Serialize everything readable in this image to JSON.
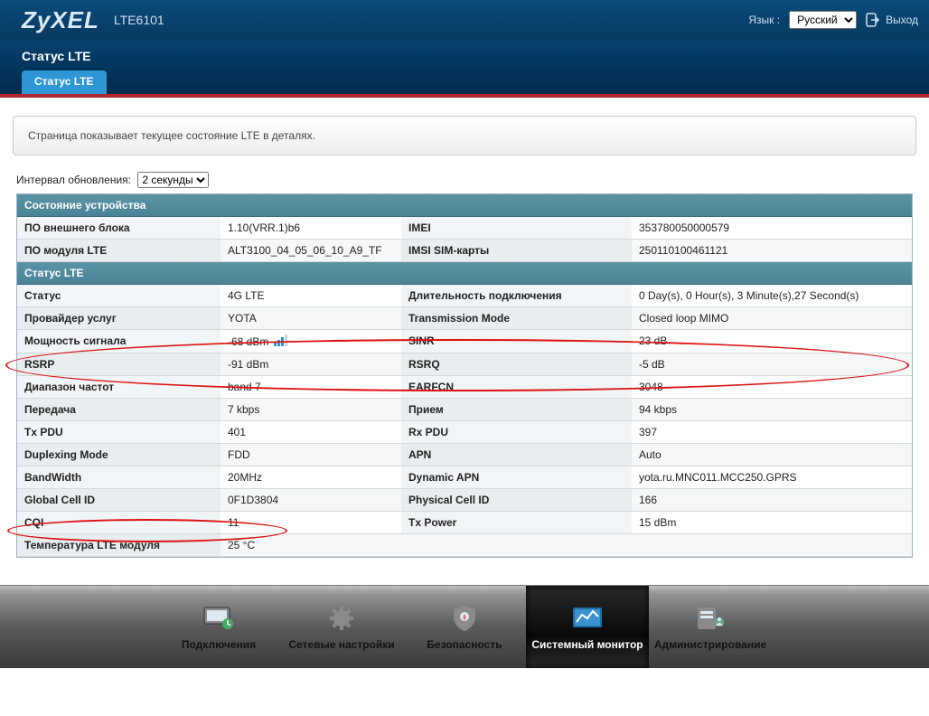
{
  "header": {
    "brand": "ZyXEL",
    "model": "LTE6101",
    "lang_label": "Язык :",
    "lang_value": "Русский",
    "logout": "Выход"
  },
  "page": {
    "title": "Статус LTE",
    "tabs": [
      {
        "label": "Статус LTE",
        "active": true
      }
    ]
  },
  "infobox": "Страница показывает текущее состояние LTE в деталях.",
  "interval": {
    "label": "Интервал обновления:",
    "value": "2 секунды"
  },
  "sections": {
    "device": {
      "title": "Состояние устройства",
      "rows": [
        {
          "l1": "ПО внешнего блока",
          "v1": "1.10(VRR.1)b6",
          "l2": "IMEI",
          "v2": "353780050000579"
        },
        {
          "l1": "ПО модуля LTE",
          "v1": "ALT3100_04_05_06_10_A9_TF",
          "l2": "IMSI SIM-карты",
          "v2": "250110100461121"
        }
      ]
    },
    "lte": {
      "title": "Статус LTE",
      "rows": [
        {
          "l1": "Статус",
          "v1": "4G LTE",
          "l2": "Длительность подключения",
          "v2": "0 Day(s), 0 Hour(s), 3 Minute(s),27 Second(s)"
        },
        {
          "l1": "Провайдер услуг",
          "v1": "YOTA",
          "l2": "Transmission Mode",
          "v2": "Closed loop MIMO"
        },
        {
          "l1": "Мощность сигнала",
          "v1": "-68 dBm",
          "l2": "SINR",
          "v2": "23 dB",
          "signal": true
        },
        {
          "l1": "RSRP",
          "v1": "-91 dBm",
          "l2": "RSRQ",
          "v2": "-5 dB"
        },
        {
          "l1": "Диапазон частот",
          "v1": "band 7",
          "l2": "EARFCN",
          "v2": "3048"
        },
        {
          "l1": "Передача",
          "v1": "7 kbps",
          "l2": "Прием",
          "v2": "94 kbps"
        },
        {
          "l1": "Tx PDU",
          "v1": "401",
          "l2": "Rx PDU",
          "v2": "397"
        },
        {
          "l1": "Duplexing Mode",
          "v1": "FDD",
          "l2": "APN",
          "v2": "Auto"
        },
        {
          "l1": "BandWidth",
          "v1": "20MHz",
          "l2": "Dynamic APN",
          "v2": "yota.ru.MNC011.MCC250.GPRS"
        },
        {
          "l1": "Global Cell ID",
          "v1": "0F1D3804",
          "l2": "Physical Cell ID",
          "v2": "166"
        },
        {
          "l1": "CQI",
          "v1": "11",
          "l2": "Tx Power",
          "v2": "15 dBm"
        }
      ],
      "single_rows": [
        {
          "l1": "Температура LTE модуля",
          "v1": "25 °C"
        }
      ]
    }
  },
  "bottomnav": {
    "items": [
      {
        "label": "Подключения",
        "icon": "monitor"
      },
      {
        "label": "Сетевые настройки",
        "icon": "gear"
      },
      {
        "label": "Безопасность",
        "icon": "shield"
      },
      {
        "label": "Системный монитор",
        "icon": "chart",
        "active": true
      },
      {
        "label": "Администрирование",
        "icon": "admin"
      }
    ]
  }
}
